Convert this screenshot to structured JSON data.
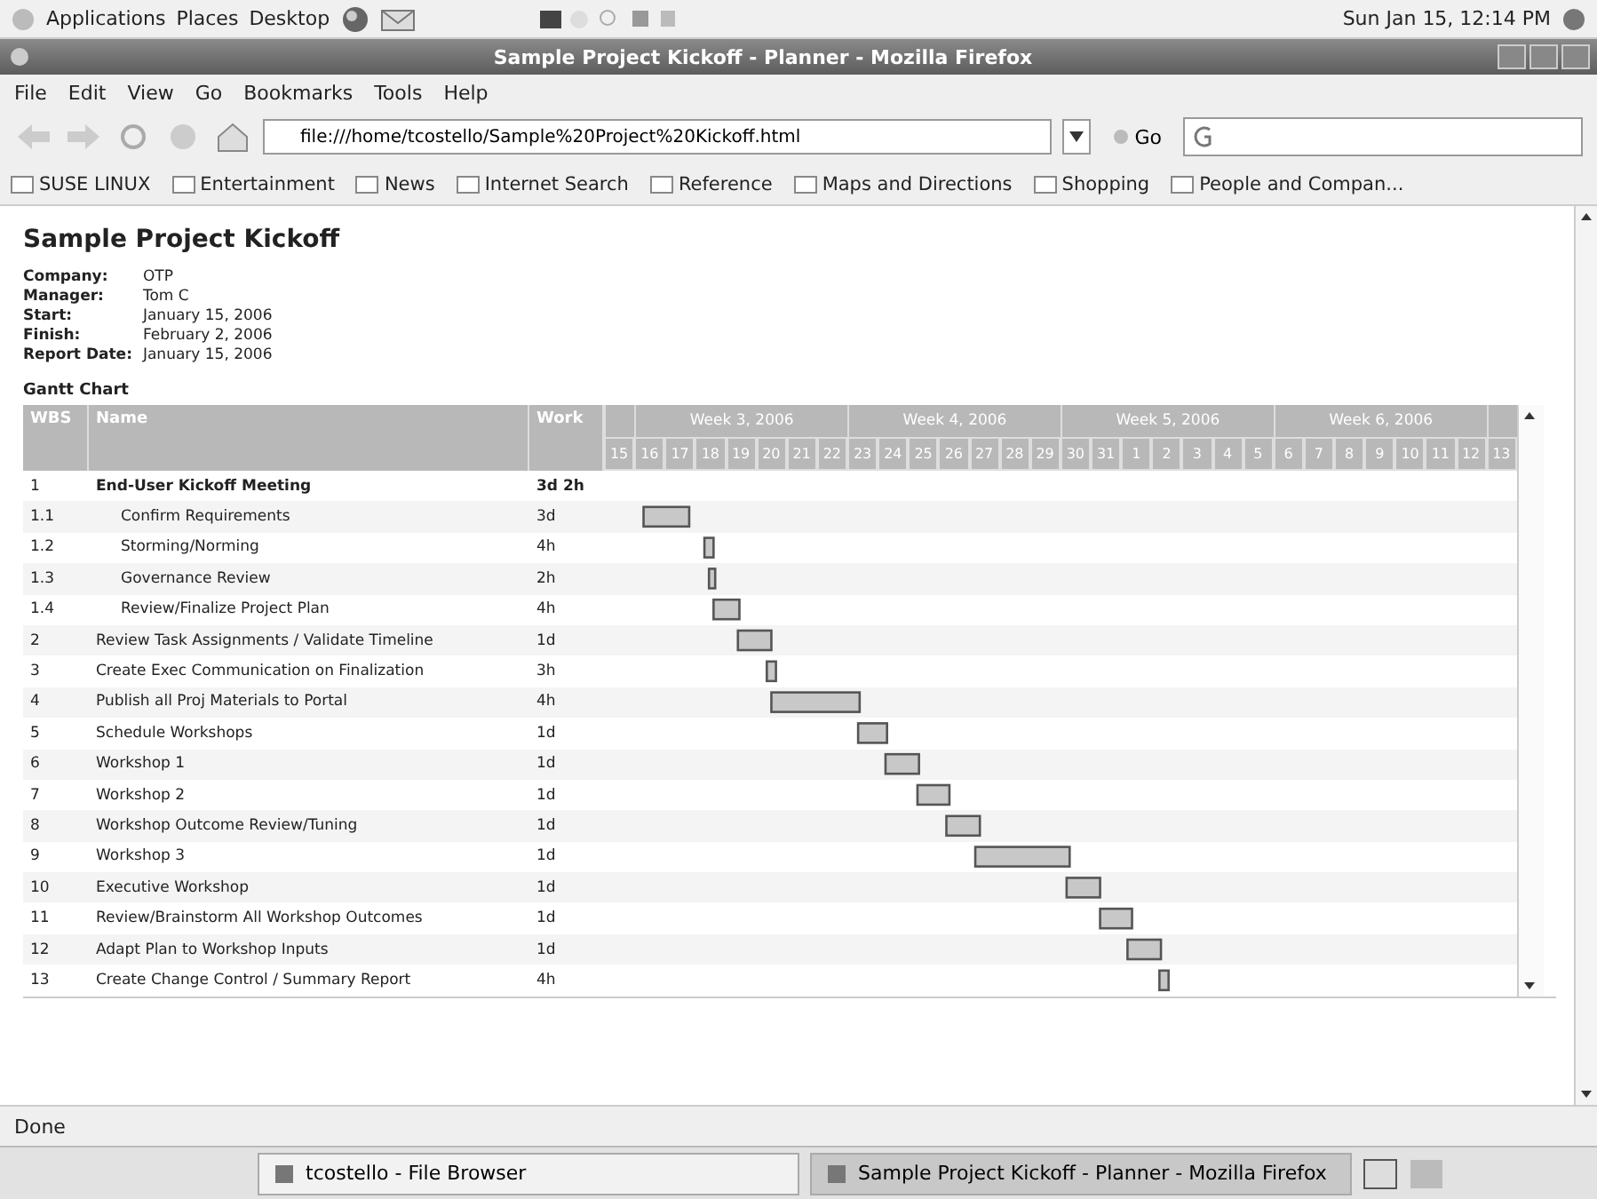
{
  "panel": {
    "menus": [
      "Applications",
      "Places",
      "Desktop"
    ],
    "clock": "Sun Jan 15, 12:14 PM"
  },
  "window": {
    "title": "Sample Project Kickoff - Planner - Mozilla Firefox"
  },
  "menu": [
    "File",
    "Edit",
    "View",
    "Go",
    "Bookmarks",
    "Tools",
    "Help"
  ],
  "toolbar": {
    "address": "file:///home/tcostello/Sample%20Project%20Kickoff.html",
    "go": "Go"
  },
  "bookmarks": [
    "SUSE LINUX",
    "Entertainment",
    "News",
    "Internet Search",
    "Reference",
    "Maps and Directions",
    "Shopping",
    "People and Compan..."
  ],
  "page": {
    "title": "Sample Project Kickoff",
    "info": [
      {
        "label": "Company:",
        "value": "OTP"
      },
      {
        "label": "Manager:",
        "value": "Tom C"
      },
      {
        "label": "Start:",
        "value": "January 15, 2006"
      },
      {
        "label": "Finish:",
        "value": "February 2, 2006"
      },
      {
        "label": "Report Date:",
        "value": "January 15, 2006"
      }
    ],
    "section": "Gantt Chart",
    "gantt": {
      "columns": [
        "WBS",
        "Name",
        "Work"
      ],
      "weeks": [
        "Week 3, 2006",
        "Week 4, 2006",
        "Week 5, 2006",
        "Week 6, 2006"
      ],
      "rows": [
        {
          "wbs": "1",
          "name": "End-User Kickoff Meeting",
          "work": "3d 2h",
          "summary": true,
          "children": [
            {
              "wbs": "1.1",
              "name": "Confirm Requirements",
              "work": "3d",
              "summary": false
            },
            {
              "wbs": "1.2",
              "name": "Storming/Norming",
              "work": "4h",
              "summary": false
            },
            {
              "wbs": "1.3",
              "name": "Governance Review",
              "work": "2h",
              "summary": false
            },
            {
              "wbs": "1.4",
              "name": "Review/Finalize Project Plan",
              "work": "4h",
              "summary": false
            }
          ]
        },
        {
          "wbs": "2",
          "name": "Review Task Assignments / Validate Timeline",
          "work": "1d",
          "summary": false
        },
        {
          "wbs": "3",
          "name": "Create Exec Communication on Finalization",
          "work": "3h",
          "summary": false
        },
        {
          "wbs": "4",
          "name": "Publish all Proj Materials to Portal",
          "work": "4h",
          "summary": false
        },
        {
          "wbs": "5",
          "name": "Schedule Workshops",
          "work": "1d",
          "summary": false
        },
        {
          "wbs": "6",
          "name": "Workshop 1",
          "work": "1d",
          "summary": false
        },
        {
          "wbs": "7",
          "name": "Workshop 2",
          "work": "1d",
          "summary": false
        },
        {
          "wbs": "8",
          "name": "Workshop Outcome Review/Tuning",
          "work": "1d",
          "summary": false
        },
        {
          "wbs": "9",
          "name": "Workshop 3",
          "work": "1d",
          "summary": false
        },
        {
          "wbs": "10",
          "name": "Executive Workshop",
          "work": "1d",
          "summary": false
        },
        {
          "wbs": "11",
          "name": "Review/Brainstorm All Workshop Outcomes",
          "work": "1d",
          "summary": false
        },
        {
          "wbs": "12",
          "name": "Adapt Plan to Workshop Inputs",
          "work": "1d",
          "summary": false
        },
        {
          "wbs": "13",
          "name": "Create Change Control / Summary Report",
          "work": "4h",
          "summary": false
        }
      ],
      "days": [
        "15",
        "16",
        "17",
        "18",
        "19",
        "20",
        "21",
        "22",
        "23",
        "24",
        "25",
        "26",
        "27",
        "28",
        "29",
        "30",
        "31",
        "1",
        "2",
        "3",
        "4",
        "5",
        "6",
        "7",
        "8",
        "9",
        "10",
        "11",
        "12",
        "13"
      ]
    }
  },
  "status": "Done",
  "taskbar": [
    {
      "label": "tcostello - File Browser",
      "selected": false
    },
    {
      "label": "Sample Project Kickoff - Planner - Mozilla Firefox",
      "selected": true
    }
  ]
}
